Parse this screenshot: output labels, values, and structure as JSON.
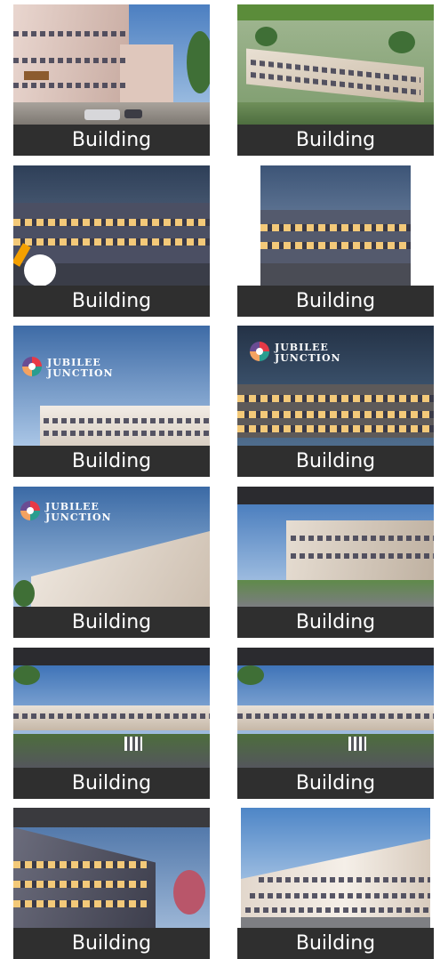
{
  "gallery": {
    "items": [
      {
        "caption": "Building"
      },
      {
        "caption": "Building"
      },
      {
        "caption": "Building"
      },
      {
        "caption": "Building"
      },
      {
        "caption": "Building"
      },
      {
        "caption": "Building"
      },
      {
        "caption": "Building"
      },
      {
        "caption": "Building"
      },
      {
        "caption": "Building"
      },
      {
        "caption": "Building"
      },
      {
        "caption": "Building"
      },
      {
        "caption": "Building"
      }
    ]
  },
  "brand": {
    "line1": "JUBILEE",
    "line2": "JUNCTION"
  },
  "colors": {
    "caption_bg": "#2f2f2f",
    "caption_text": "#ffffff",
    "sky_day": "#6f9cd3",
    "sky_dusk": "#34465f"
  }
}
